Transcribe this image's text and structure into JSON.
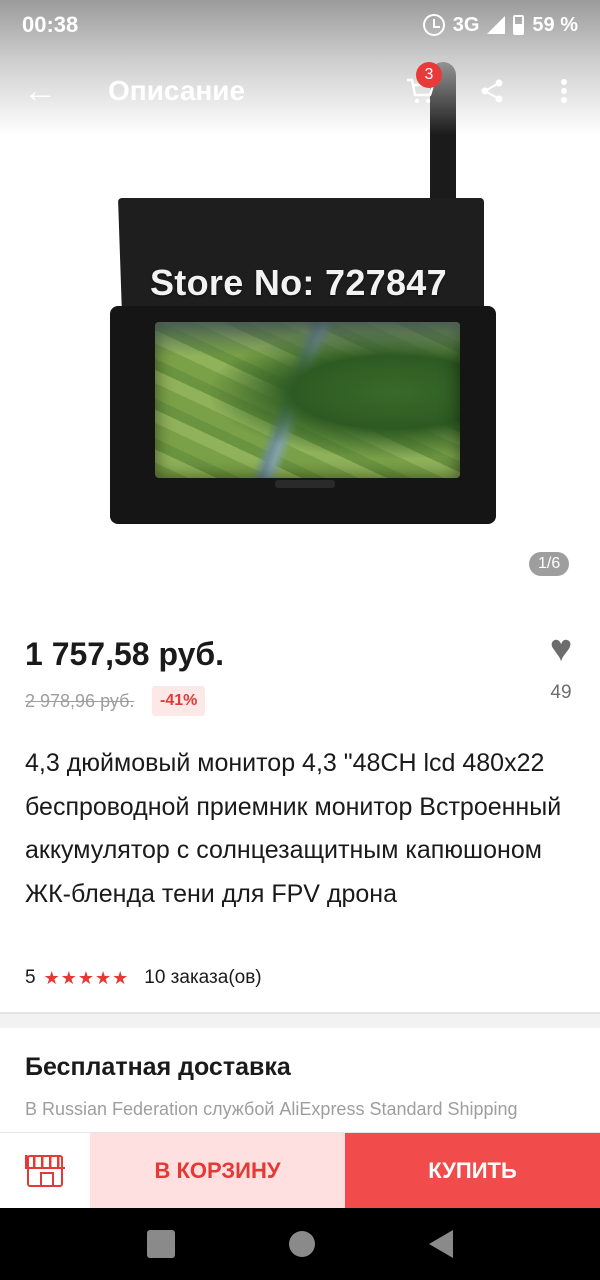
{
  "status_bar": {
    "time": "00:38",
    "network": "3G",
    "battery": "59 %",
    "icons": [
      "alarm-icon",
      "signal-icon",
      "battery-icon"
    ]
  },
  "toolbar": {
    "back_icon": "arrow-left-icon",
    "title": "Описание",
    "cart_badge": "3",
    "icons": [
      "cart-icon",
      "share-icon",
      "more-vert-icon"
    ]
  },
  "image": {
    "store_label": "Store No: 727847",
    "counter": "1/6"
  },
  "product": {
    "price": "1 757,58 руб.",
    "old_price": "2 978,96 руб.",
    "discount": "-41%",
    "wishlist_count": "49",
    "title": "4,3 дюймовый монитор 4,3 \"48CH lcd 480x22 беспроводной приемник монитор Встроенный аккумулятор с солнцезащитным капюшоном ЖК-бленда тени для FPV дрона",
    "rating": "5",
    "stars": "★★★★★",
    "orders": "10 заказа(ов)"
  },
  "shipping": {
    "title": "Бесплатная доставка",
    "subtitle": "В Russian Federation службой AliExpress Standard Shipping"
  },
  "actions": {
    "store_icon": "store-icon",
    "add_to_cart": "В КОРЗИНУ",
    "buy": "КУПИТЬ"
  },
  "colors": {
    "accent": "#e53935",
    "buy_button": "#f24b4b",
    "cart_button_bg": "#fde0df",
    "secondary_text": "#9e9e9e"
  }
}
